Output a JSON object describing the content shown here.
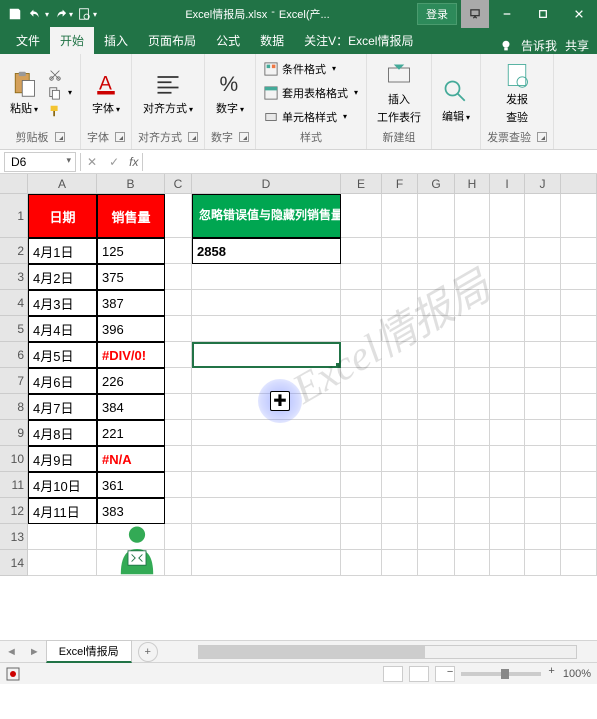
{
  "titlebar": {
    "filename": "Excel情报局.xlsx",
    "app": "Excel(产...",
    "login": "登录"
  },
  "tabs": {
    "file": "文件",
    "home": "开始",
    "insert": "插入",
    "layout": "页面布局",
    "formulas": "公式",
    "data": "数据",
    "follow": "关注V：Excel情报局",
    "tellme": "告诉我",
    "share": "共享"
  },
  "ribbon": {
    "clipboard": {
      "paste": "粘贴",
      "label": "剪贴板"
    },
    "font": {
      "btn": "字体",
      "label": "字体"
    },
    "align": {
      "btn": "对齐方式",
      "label": "对齐方式"
    },
    "number": {
      "btn": "数字",
      "label": "数字"
    },
    "styles": {
      "cond": "条件格式",
      "table": "套用表格格式",
      "cell": "单元格样式",
      "label": "样式"
    },
    "addins": {
      "insert": "插入",
      "worksheet": "工作表行",
      "label": "新建组"
    },
    "editing": {
      "btn": "编辑",
      "label": ""
    },
    "invoice": {
      "btn": "发报",
      "sub": "查验",
      "label": "发票查验"
    }
  },
  "formulabar": {
    "namebox": "D6",
    "cancel": "✕",
    "confirm": "✓",
    "fx": "fx"
  },
  "columns": [
    "A",
    "B",
    "C",
    "D",
    "E",
    "F",
    "G",
    "H",
    "I",
    "J"
  ],
  "headers": {
    "date": "日期",
    "sales": "销售量",
    "summary": "忽略错误值与隐藏列销售量汇总"
  },
  "summary_value": "2858",
  "rows": [
    {
      "n": 2,
      "date": "4月1日",
      "sales": "125"
    },
    {
      "n": 3,
      "date": "4月2日",
      "sales": "375"
    },
    {
      "n": 4,
      "date": "4月3日",
      "sales": "387"
    },
    {
      "n": 5,
      "date": "4月4日",
      "sales": "396"
    },
    {
      "n": 6,
      "date": "4月5日",
      "sales": "#DIV/0!",
      "err": true
    },
    {
      "n": 7,
      "date": "4月6日",
      "sales": "226"
    },
    {
      "n": 8,
      "date": "4月7日",
      "sales": "384"
    },
    {
      "n": 9,
      "date": "4月8日",
      "sales": "221"
    },
    {
      "n": 10,
      "date": "4月9日",
      "sales": "#N/A",
      "err": true
    },
    {
      "n": 11,
      "date": "4月10日",
      "sales": "361"
    },
    {
      "n": 12,
      "date": "4月11日",
      "sales": "383"
    }
  ],
  "watermark": "Excel情报局",
  "sheet": {
    "name": "Excel情报局"
  },
  "statusbar": {
    "ready": "",
    "zoom": "100%"
  }
}
